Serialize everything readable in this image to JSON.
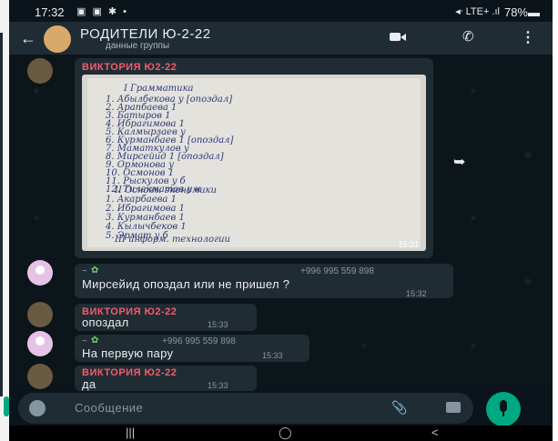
{
  "status_bar": {
    "time": "17:32",
    "icons": "▣ ▣ ✱ •",
    "signal": "◂ᐧ LTE+ .ıl",
    "battery": "78%▬"
  },
  "header": {
    "back_icon": "arrow-left",
    "title": "РОДИТЕЛИ Ю-2-22",
    "subtitle": "данные группы",
    "video_call_icon": "video-icon",
    "voice_call_icon": "phone-icon",
    "more_icon": "more-vertical-icon"
  },
  "messages": [
    {
      "sender": "ВИКТОРИЯ Ю2-22",
      "type": "image",
      "time": "15:31",
      "image_text": {
        "heading1": "I  Грамматика",
        "list1": [
          "1. Абылбекова  y  [опоздал]",
          "2. Арапбаева  1",
          "3. Батыров  1",
          "4. Ибрагимова  1",
          "5. Калмырзаев  y",
          "6. Курманбаев  1  [опоздал]",
          "7. Маматкулов  y",
          "8. Мирсейид  1  [опоздал]",
          "9. Ормонова  y",
          "10. Осмонов  1",
          "11. Рыскулов  y  б",
          "12. Тилекматов  y  н"
        ],
        "heading2": "II  Основы  экономики",
        "list2": [
          "1. Акарбаева  1",
          "2. Ибрагимова  1",
          "3. Курманбаев  1",
          "4. Кылычбеков  1",
          "5. Эрмат  y  б"
        ],
        "heading3": "III  информ. технологии"
      }
    },
    {
      "sender_prefix": "~",
      "phone": "+996 995 559 898",
      "text": "Мирсейид опоздал или не пришел ?",
      "time": "15:32"
    },
    {
      "sender": "ВИКТОРИЯ Ю2-22",
      "text": "опоздал",
      "time": "15:33"
    },
    {
      "sender_prefix": "~",
      "phone": "+996 995 559 898",
      "text": "На первую пару",
      "time": "15:33"
    },
    {
      "sender": "ВИКТОРИЯ Ю2-22",
      "text": "да",
      "time": "15:33"
    }
  ],
  "input": {
    "placeholder": "Сообщение"
  },
  "nav": {
    "recent": "|||",
    "home": "◯",
    "back": "<"
  },
  "colors": {
    "header_bg": "#1f2c34",
    "chat_bg": "#0b141a",
    "bubble_bg": "#202c33",
    "sender_name": "#f15c6d",
    "accent": "#00a884"
  }
}
